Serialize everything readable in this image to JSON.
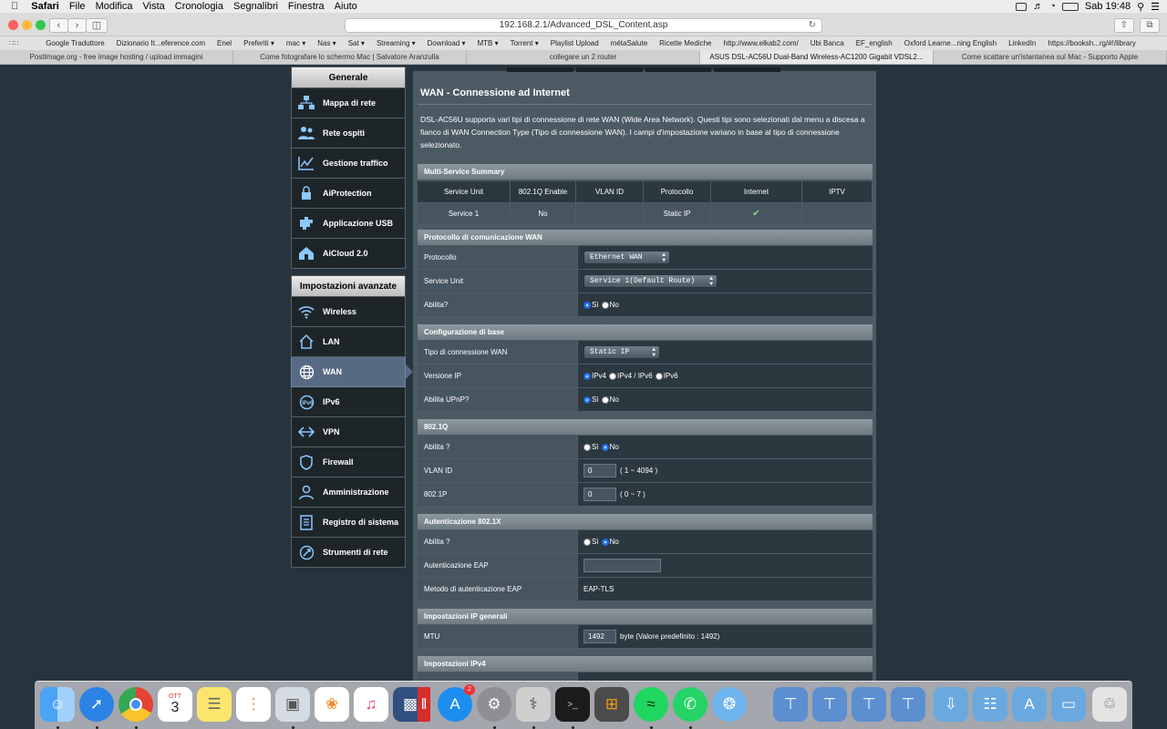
{
  "menubar": {
    "app": "Safari",
    "items": [
      "File",
      "Modifica",
      "Vista",
      "Cronologia",
      "Segnalibri",
      "Finestra",
      "Aiuto"
    ],
    "clock": "Sab 19:48"
  },
  "toolbar": {
    "url": "192.168.2.1/Advanced_DSL_Content.asp"
  },
  "bookmarks": [
    "Google Traduttore",
    "Dizionario It...eference.com",
    "Enel",
    "Preferiti ▾",
    "mac ▾",
    "Nas ▾",
    "Sat ▾",
    "Streaming ▾",
    "Download ▾",
    "MTB ▾",
    "Torrent ▾",
    "Playlist Upload",
    "métaSalute",
    "Ricette Mediche",
    "http://www.elkab2.com/",
    "Ubi Banca",
    "EF_english",
    "Oxford Learne...ning English",
    "LinkedIn",
    "https://booksh...rg/#!/library"
  ],
  "tabs": [
    "PostImage.org - free image hosting / upload immagini",
    "Come fotografare lo schermo Mac | Salvatore Aranzulla",
    "collegare un 2 router",
    "ASUS DSL-AC56U Dual-Band Wireless-AC1200 Gigabit VDSL2...",
    "Come scattare un'istantanea sul Mac - Supporto Apple"
  ],
  "sidebar": {
    "general_title": "Generale",
    "general": [
      {
        "label": "Mappa di rete",
        "icon": "network-map-icon"
      },
      {
        "label": "Rete ospiti",
        "icon": "guest-network-icon"
      },
      {
        "label": "Gestione traffico",
        "icon": "traffic-manager-icon"
      },
      {
        "label": "AiProtection",
        "icon": "aiprotection-icon"
      },
      {
        "label": "Applicazione USB",
        "icon": "usb-application-icon"
      },
      {
        "label": "AiCloud 2.0",
        "icon": "aicloud-icon"
      }
    ],
    "advanced_title": "Impostazioni avanzate",
    "advanced": [
      {
        "label": "Wireless",
        "icon": "wireless-icon"
      },
      {
        "label": "LAN",
        "icon": "lan-icon"
      },
      {
        "label": "WAN",
        "icon": "wan-icon"
      },
      {
        "label": "IPv6",
        "icon": "ipv6-icon"
      },
      {
        "label": "VPN",
        "icon": "vpn-icon"
      },
      {
        "label": "Firewall",
        "icon": "firewall-icon"
      },
      {
        "label": "Amministrazione",
        "icon": "administration-icon"
      },
      {
        "label": "Registro di sistema",
        "icon": "system-log-icon"
      },
      {
        "label": "Strumenti di rete",
        "icon": "network-tools-icon"
      }
    ],
    "active": "WAN"
  },
  "main": {
    "title": "WAN - Connessione ad Internet",
    "description": "DSL-AC56U supporta vari tipi di connessione di rete WAN (Wide Area Network). Questi tipi sono selezionati dal menu a discesa a fianco di WAN Connection Type (Tipo di connessione WAN). I campi d'impostazione variano in base al tipo di connessione selezionato.",
    "summary": {
      "title": "Multi-Service Summary",
      "headers": [
        "Service Unit",
        "802.1Q Enable",
        "VLAN ID",
        "Protocollo",
        "Internet",
        "IPTV"
      ],
      "row": [
        "Service 1",
        "No",
        "",
        "Static IP",
        "✔",
        ""
      ]
    },
    "protocol": {
      "title": "Protocollo di comunicazione WAN",
      "protocol_label": "Protocollo",
      "protocol_value": "Ethernet WAN",
      "service_label": "Service Unit",
      "service_value": "Service 1(Default Route)",
      "enable_label": "Abilita?",
      "yes": "Sì",
      "no": "No"
    },
    "basic": {
      "title": "Configurazione di base",
      "wan_type_label": "Tipo di connessione WAN",
      "wan_type_value": "Static IP",
      "ip_version_label": "Versione IP",
      "ipv4": "IPv4",
      "ipv4v6": "IPv4 / IPv6",
      "ipv6": "IPv6",
      "upnp_label": "Abilita UPnP?",
      "yes": "Sì",
      "no": "No"
    },
    "dot1q": {
      "title": "802.1Q",
      "enable_label": "Abilita ?",
      "yes": "Sì",
      "no": "No",
      "vlan_label": "VLAN ID",
      "vlan_value": "0",
      "vlan_hint": "( 1 ~ 4094 )",
      "p_label": "802.1P",
      "p_value": "0",
      "p_hint": "( 0 ~ 7 )"
    },
    "auth": {
      "title": "Autenticazione 802.1X",
      "enable_label": "Abilita ?",
      "yes": "Sì",
      "no": "No",
      "eap_label": "Autenticazione EAP",
      "eap_value": "",
      "method_label": "Metodo di autenticazione EAP",
      "method_value": "EAP-TLS"
    },
    "ipgen": {
      "title": "Impostazioni IP generali",
      "mtu_label": "MTU",
      "mtu_value": "1492",
      "mtu_hint": "byte (Valore predefinito : 1492)"
    },
    "ipv4": {
      "title": "Impostazioni IPv4"
    }
  },
  "dock": {
    "calendar_month": "OTT",
    "calendar_day": "3",
    "appstore_badge": "2"
  }
}
